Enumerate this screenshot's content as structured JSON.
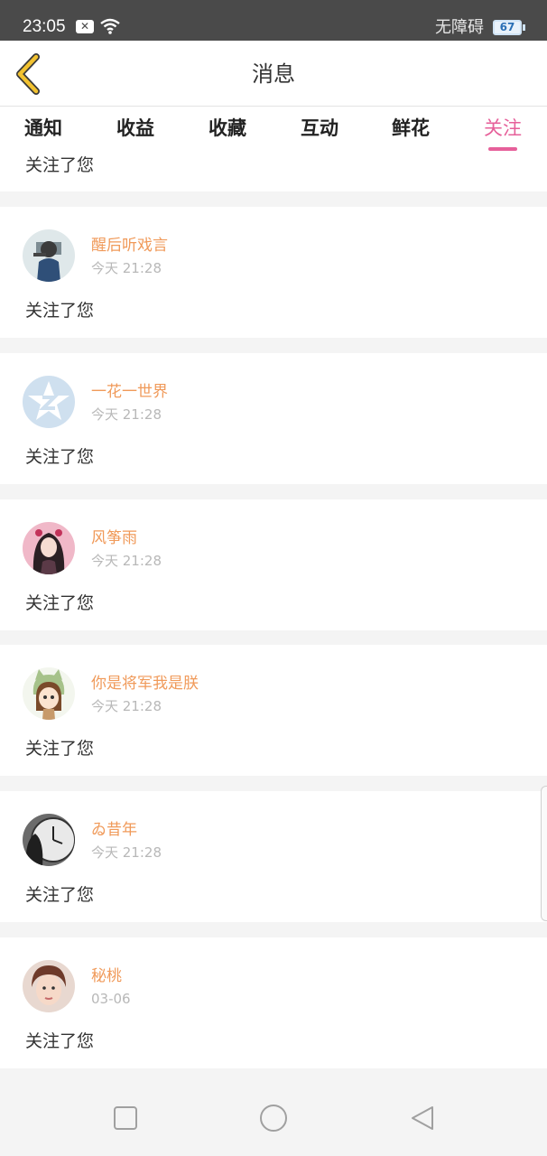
{
  "status_bar": {
    "time": "23:05",
    "accessibility": "无障碍",
    "battery": "67"
  },
  "header": {
    "title": "消息"
  },
  "tabs": [
    {
      "label": "通知"
    },
    {
      "label": "收益"
    },
    {
      "label": "收藏"
    },
    {
      "label": "互动"
    },
    {
      "label": "鲜花"
    },
    {
      "label": "关注",
      "active": true
    }
  ],
  "partial_item": {
    "text": "关注了您"
  },
  "messages": [
    {
      "name": "醒后听戏言",
      "time": "今天 21:28",
      "text": "关注了您",
      "avatar": "avatar-girl-blue-coat"
    },
    {
      "name": "一花一世界",
      "time": "今天 21:28",
      "text": "关注了您",
      "avatar": "avatar-default-star"
    },
    {
      "name": "风筝雨",
      "time": "今天 21:28",
      "text": "关注了您",
      "avatar": "avatar-doll-pink"
    },
    {
      "name": "你是将军我是朕",
      "time": "今天 21:28",
      "text": "关注了您",
      "avatar": "avatar-cartoon-cat-hood"
    },
    {
      "name": "ゐ昔年",
      "time": "今天 21:28",
      "text": "关注了您",
      "avatar": "avatar-clock-girl"
    },
    {
      "name": "秘桃",
      "time": "03-06",
      "text": "关注了您",
      "avatar": "avatar-boy-portrait"
    }
  ],
  "colors": {
    "accent": "#e6609a",
    "name": "#f09a5a",
    "back_arrow": "#f2c230"
  }
}
